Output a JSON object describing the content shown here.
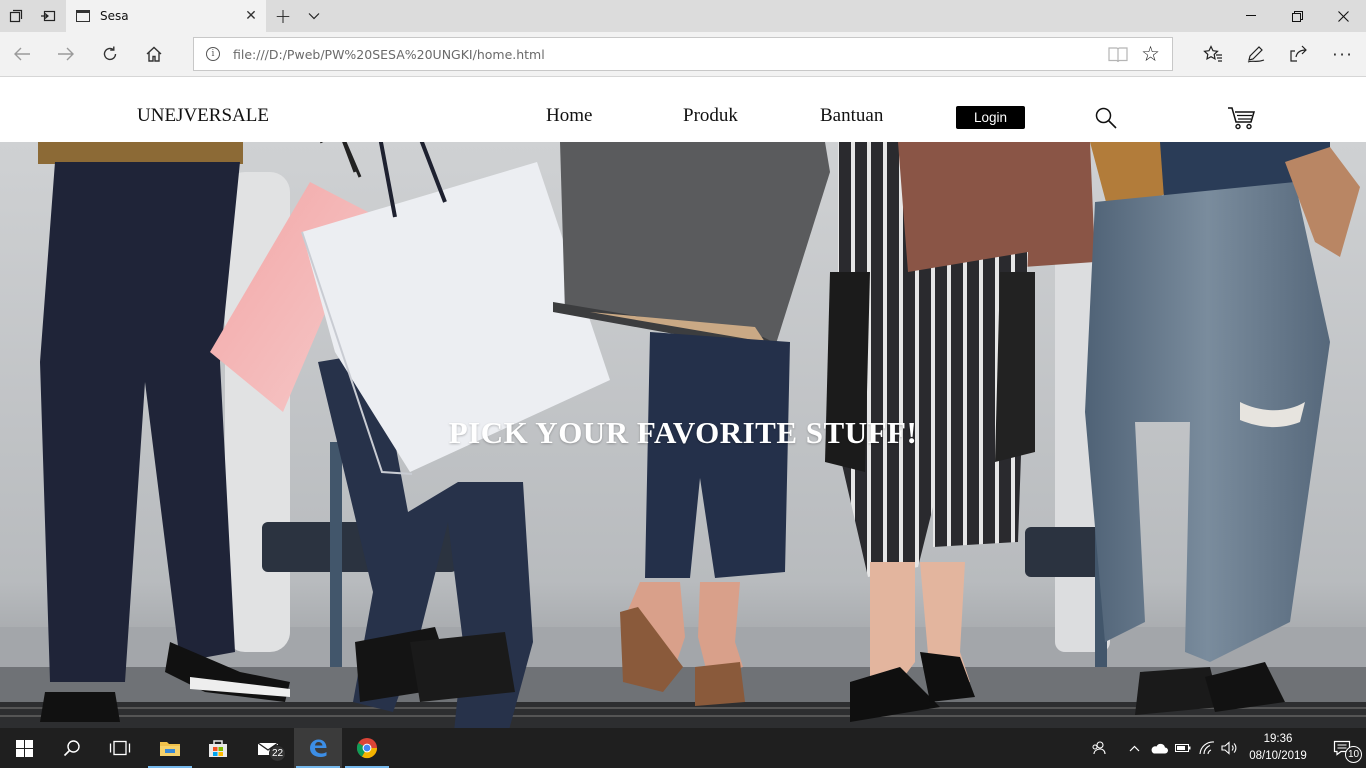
{
  "browser": {
    "tab_title": "Sesa",
    "url": "file:///D:/Pweb/PW%20SESA%20UNGKI/home.html"
  },
  "site": {
    "brand": "UNEJVERSALE",
    "nav": [
      {
        "label": "Home"
      },
      {
        "label": "Produk"
      },
      {
        "label": "Bantuan"
      }
    ],
    "login_label": "Login",
    "hero_heading": "PICK YOUR FAVORITE STUFF!"
  },
  "taskbar": {
    "mail_badge": "22",
    "time": "19:36",
    "date": "08/10/2019",
    "notification_count": "10"
  },
  "colors": {
    "taskbar": "#1f1f1f",
    "chrome": "#f2f2f2",
    "login_bg": "#000000",
    "hero_text": "#ffffff",
    "active_indicator": "#76b9ed"
  }
}
